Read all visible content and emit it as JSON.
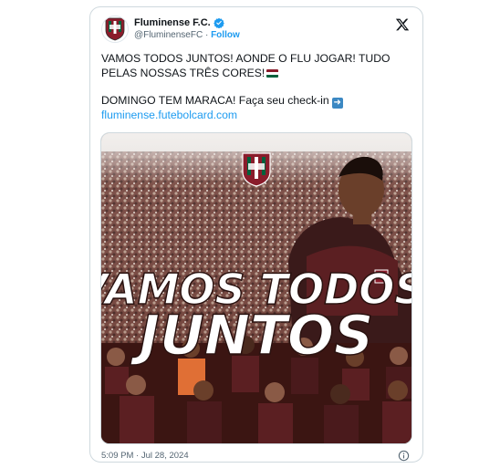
{
  "account": {
    "display_name": "Fluminense F.C.",
    "handle": "@FluminenseFC",
    "separator": "·",
    "follow_label": "Follow",
    "verified": true,
    "avatar_icon": "fluminense-crest-icon"
  },
  "post": {
    "lines": [
      "VAMOS TODOS JUNTOS! AONDE O FLU JOGAR! TUDO",
      "PELAS NOSSAS TRÊS CORES!",
      "DOMINGO TEM MARACA! Faça seu check-in"
    ],
    "link": "fluminense.futebolcard.com",
    "emojis": [
      "hungary-flag-icon",
      "right-arrow-icon"
    ]
  },
  "media": {
    "headline_line1": "VAMOS TODOS",
    "headline_line2": "JUNTOS",
    "crest_icon": "fluminense-crest-icon"
  },
  "footer": {
    "time": "5:09 PM",
    "separator": "·",
    "date": "Jul 28, 2024"
  },
  "colors": {
    "grena": "#8a1c2b",
    "verde": "#00613c",
    "link": "#1d9bf0",
    "muted": "#536471"
  }
}
